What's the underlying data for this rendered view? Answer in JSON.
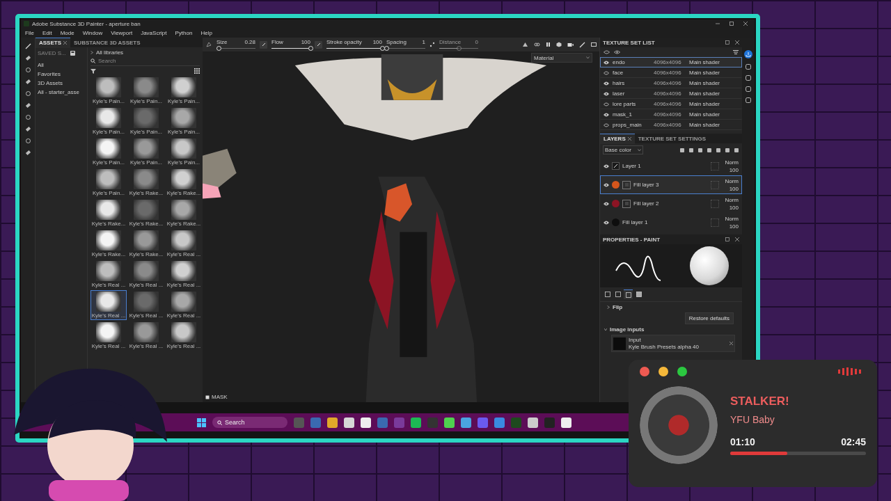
{
  "window": {
    "title": "Adobe Substance 3D Painter - aperture ban"
  },
  "menu": [
    "File",
    "Edit",
    "Mode",
    "Window",
    "Viewport",
    "JavaScript",
    "Python",
    "Help"
  ],
  "assets": {
    "tabs": [
      {
        "label": "ASSETS",
        "selected": true
      },
      {
        "label": "SUBSTANCE 3D ASSETS",
        "selected": false
      }
    ],
    "saved_label": "SAVED S...",
    "filters": [
      "All",
      "Favorites",
      "3D Assets",
      "All - starter_asse"
    ],
    "breadcrumb": "All libraries",
    "search": {
      "placeholder": "Search"
    },
    "thumbnails": [
      {
        "label": "Kyle's Pain...",
        "selected": false
      },
      {
        "label": "Kyle's Pain...",
        "selected": false
      },
      {
        "label": "Kyle's Pain...",
        "selected": false
      },
      {
        "label": "Kyle's Pain...",
        "selected": false
      },
      {
        "label": "Kyle's Pain...",
        "selected": false
      },
      {
        "label": "Kyle's Pain...",
        "selected": false
      },
      {
        "label": "Kyle's Pain...",
        "selected": false
      },
      {
        "label": "Kyle's Pain...",
        "selected": false
      },
      {
        "label": "Kyle's Pain...",
        "selected": false
      },
      {
        "label": "Kyle's Pain...",
        "selected": false
      },
      {
        "label": "Kyle's Rake...",
        "selected": false
      },
      {
        "label": "Kyle's Rake...",
        "selected": false
      },
      {
        "label": "Kyle's Rake...",
        "selected": false
      },
      {
        "label": "Kyle's Rake...",
        "selected": false
      },
      {
        "label": "Kyle's Rake...",
        "selected": false
      },
      {
        "label": "Kyle's Rake...",
        "selected": false
      },
      {
        "label": "Kyle's Rake...",
        "selected": false
      },
      {
        "label": "Kyle's Real ...",
        "selected": false
      },
      {
        "label": "Kyle's Real ...",
        "selected": false
      },
      {
        "label": "Kyle's Real ...",
        "selected": false
      },
      {
        "label": "Kyle's Real ...",
        "selected": false
      },
      {
        "label": "Kyle's Real ...",
        "selected": true
      },
      {
        "label": "Kyle's Real ...",
        "selected": false
      },
      {
        "label": "Kyle's Real ...",
        "selected": false
      },
      {
        "label": "Kyle's Real ...",
        "selected": false
      },
      {
        "label": "Kyle's Real ...",
        "selected": false
      },
      {
        "label": "Kyle's Real ...",
        "selected": false
      }
    ]
  },
  "toolbar": {
    "sliders": [
      {
        "label": "Size",
        "reading": "0.28",
        "level": 0.05,
        "disabled": false
      },
      {
        "label": "Flow",
        "reading": "100",
        "level": 1,
        "disabled": false
      },
      {
        "label": "Stroke opacity",
        "reading": "100",
        "level": 1,
        "disabled": false
      },
      {
        "label": "Spacing",
        "reading": "1",
        "level": 0,
        "disabled": false
      },
      {
        "label": "Distance",
        "reading": "0",
        "level": 0.5,
        "disabled": true
      }
    ]
  },
  "viewport": {
    "mode": "Material",
    "mask_label": "MASK"
  },
  "texture_set_list": {
    "title": "TEXTURE SET LIST",
    "rows": [
      {
        "name": "endo",
        "resolution": "4096x4096",
        "shader": "Main shader",
        "visible": true,
        "selected": true
      },
      {
        "name": "face",
        "resolution": "4096x4096",
        "shader": "Main shader",
        "visible": false,
        "selected": false
      },
      {
        "name": "hairs",
        "resolution": "4096x4096",
        "shader": "Main shader",
        "visible": true,
        "selected": false
      },
      {
        "name": "laser",
        "resolution": "4096x4096",
        "shader": "Main shader",
        "visible": true,
        "selected": false
      },
      {
        "name": "lore parts",
        "resolution": "4096x4096",
        "shader": "Main shader",
        "visible": false,
        "selected": false
      },
      {
        "name": "mask_1",
        "resolution": "4096x4096",
        "shader": "Main shader",
        "visible": true,
        "selected": false
      },
      {
        "name": "props_main",
        "resolution": "4096x4096",
        "shader": "Main shader",
        "visible": false,
        "selected": false
      }
    ]
  },
  "layers_panel": {
    "tabs": [
      {
        "label": "LAYERS",
        "selected": true
      },
      {
        "label": "TEXTURE SET SETTINGS",
        "selected": false
      }
    ],
    "channel": "Base color",
    "layers": [
      {
        "kind": "paint",
        "name": "Layer 1",
        "blend": "Norm",
        "opacity": "100",
        "selected": false
      },
      {
        "kind": "fill",
        "name": "Fill layer 3",
        "color": "#d4561c",
        "masked": true,
        "blend": "Norm",
        "opacity": "100",
        "selected": true
      },
      {
        "kind": "fill",
        "name": "Fill layer 2",
        "color": "#8c1424",
        "masked": true,
        "blend": "Norm",
        "opacity": "100",
        "selected": false
      },
      {
        "kind": "fill",
        "name": "Fill layer 1",
        "color": "#0e0e0e",
        "masked": false,
        "blend": "Norm",
        "opacity": "100",
        "selected": false
      }
    ]
  },
  "properties": {
    "title": "PROPERTIES - PAINT",
    "tabs": [
      {
        "selected": false
      },
      {
        "selected": false
      },
      {
        "selected": true
      },
      {
        "selected": false
      }
    ],
    "flip": {
      "title": "Flip",
      "expanded": false
    },
    "restore_button": "Restore defaults",
    "image_inputs": {
      "title": "Image inputs",
      "expanded": true
    },
    "input": {
      "title": "Input",
      "value": "Kyle Brush Presets alpha 40"
    }
  },
  "taskbar": {
    "search": {
      "placeholder": "Search"
    }
  },
  "player": {
    "title": "STALKER!",
    "artist": "YFU Baby",
    "elapsed": "01:10",
    "duration": "02:45",
    "level": 0.42
  }
}
